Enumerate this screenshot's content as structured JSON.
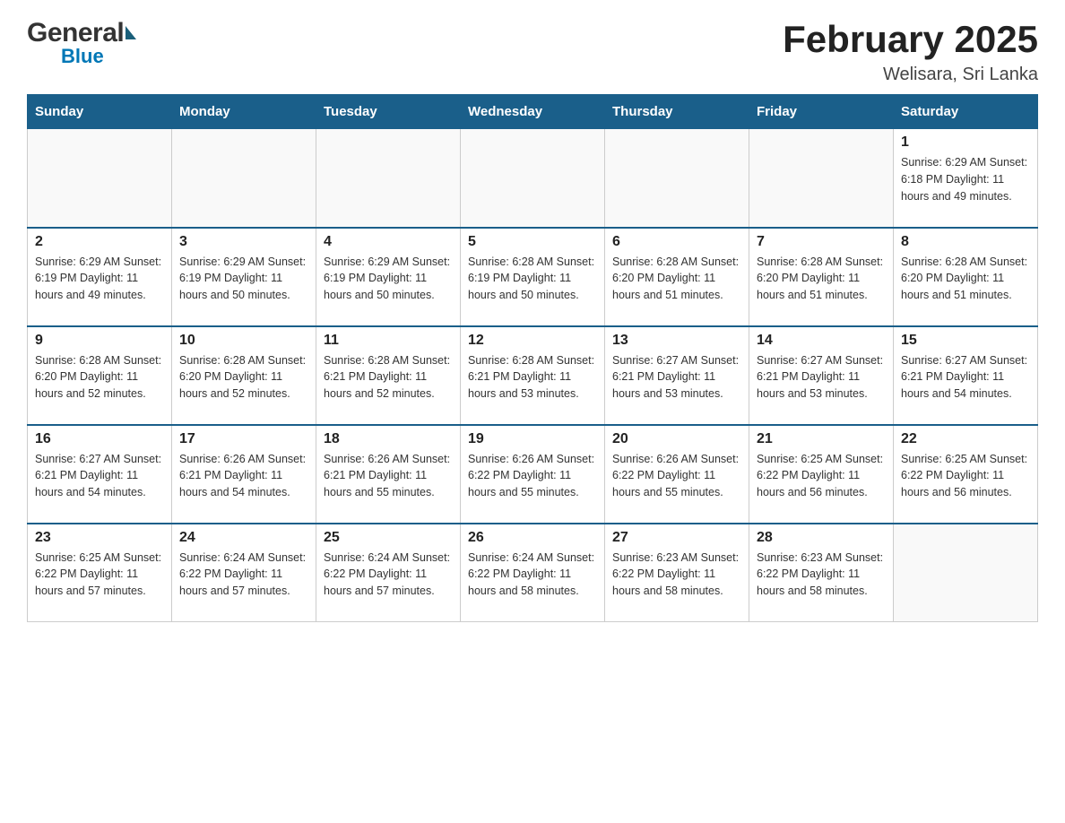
{
  "header": {
    "logo_general": "General",
    "logo_blue": "Blue",
    "title": "February 2025",
    "subtitle": "Welisara, Sri Lanka"
  },
  "weekdays": [
    "Sunday",
    "Monday",
    "Tuesday",
    "Wednesday",
    "Thursday",
    "Friday",
    "Saturday"
  ],
  "weeks": [
    [
      {
        "day": "",
        "info": ""
      },
      {
        "day": "",
        "info": ""
      },
      {
        "day": "",
        "info": ""
      },
      {
        "day": "",
        "info": ""
      },
      {
        "day": "",
        "info": ""
      },
      {
        "day": "",
        "info": ""
      },
      {
        "day": "1",
        "info": "Sunrise: 6:29 AM\nSunset: 6:18 PM\nDaylight: 11 hours and 49 minutes."
      }
    ],
    [
      {
        "day": "2",
        "info": "Sunrise: 6:29 AM\nSunset: 6:19 PM\nDaylight: 11 hours and 49 minutes."
      },
      {
        "day": "3",
        "info": "Sunrise: 6:29 AM\nSunset: 6:19 PM\nDaylight: 11 hours and 50 minutes."
      },
      {
        "day": "4",
        "info": "Sunrise: 6:29 AM\nSunset: 6:19 PM\nDaylight: 11 hours and 50 minutes."
      },
      {
        "day": "5",
        "info": "Sunrise: 6:28 AM\nSunset: 6:19 PM\nDaylight: 11 hours and 50 minutes."
      },
      {
        "day": "6",
        "info": "Sunrise: 6:28 AM\nSunset: 6:20 PM\nDaylight: 11 hours and 51 minutes."
      },
      {
        "day": "7",
        "info": "Sunrise: 6:28 AM\nSunset: 6:20 PM\nDaylight: 11 hours and 51 minutes."
      },
      {
        "day": "8",
        "info": "Sunrise: 6:28 AM\nSunset: 6:20 PM\nDaylight: 11 hours and 51 minutes."
      }
    ],
    [
      {
        "day": "9",
        "info": "Sunrise: 6:28 AM\nSunset: 6:20 PM\nDaylight: 11 hours and 52 minutes."
      },
      {
        "day": "10",
        "info": "Sunrise: 6:28 AM\nSunset: 6:20 PM\nDaylight: 11 hours and 52 minutes."
      },
      {
        "day": "11",
        "info": "Sunrise: 6:28 AM\nSunset: 6:21 PM\nDaylight: 11 hours and 52 minutes."
      },
      {
        "day": "12",
        "info": "Sunrise: 6:28 AM\nSunset: 6:21 PM\nDaylight: 11 hours and 53 minutes."
      },
      {
        "day": "13",
        "info": "Sunrise: 6:27 AM\nSunset: 6:21 PM\nDaylight: 11 hours and 53 minutes."
      },
      {
        "day": "14",
        "info": "Sunrise: 6:27 AM\nSunset: 6:21 PM\nDaylight: 11 hours and 53 minutes."
      },
      {
        "day": "15",
        "info": "Sunrise: 6:27 AM\nSunset: 6:21 PM\nDaylight: 11 hours and 54 minutes."
      }
    ],
    [
      {
        "day": "16",
        "info": "Sunrise: 6:27 AM\nSunset: 6:21 PM\nDaylight: 11 hours and 54 minutes."
      },
      {
        "day": "17",
        "info": "Sunrise: 6:26 AM\nSunset: 6:21 PM\nDaylight: 11 hours and 54 minutes."
      },
      {
        "day": "18",
        "info": "Sunrise: 6:26 AM\nSunset: 6:21 PM\nDaylight: 11 hours and 55 minutes."
      },
      {
        "day": "19",
        "info": "Sunrise: 6:26 AM\nSunset: 6:22 PM\nDaylight: 11 hours and 55 minutes."
      },
      {
        "day": "20",
        "info": "Sunrise: 6:26 AM\nSunset: 6:22 PM\nDaylight: 11 hours and 55 minutes."
      },
      {
        "day": "21",
        "info": "Sunrise: 6:25 AM\nSunset: 6:22 PM\nDaylight: 11 hours and 56 minutes."
      },
      {
        "day": "22",
        "info": "Sunrise: 6:25 AM\nSunset: 6:22 PM\nDaylight: 11 hours and 56 minutes."
      }
    ],
    [
      {
        "day": "23",
        "info": "Sunrise: 6:25 AM\nSunset: 6:22 PM\nDaylight: 11 hours and 57 minutes."
      },
      {
        "day": "24",
        "info": "Sunrise: 6:24 AM\nSunset: 6:22 PM\nDaylight: 11 hours and 57 minutes."
      },
      {
        "day": "25",
        "info": "Sunrise: 6:24 AM\nSunset: 6:22 PM\nDaylight: 11 hours and 57 minutes."
      },
      {
        "day": "26",
        "info": "Sunrise: 6:24 AM\nSunset: 6:22 PM\nDaylight: 11 hours and 58 minutes."
      },
      {
        "day": "27",
        "info": "Sunrise: 6:23 AM\nSunset: 6:22 PM\nDaylight: 11 hours and 58 minutes."
      },
      {
        "day": "28",
        "info": "Sunrise: 6:23 AM\nSunset: 6:22 PM\nDaylight: 11 hours and 58 minutes."
      },
      {
        "day": "",
        "info": ""
      }
    ]
  ]
}
